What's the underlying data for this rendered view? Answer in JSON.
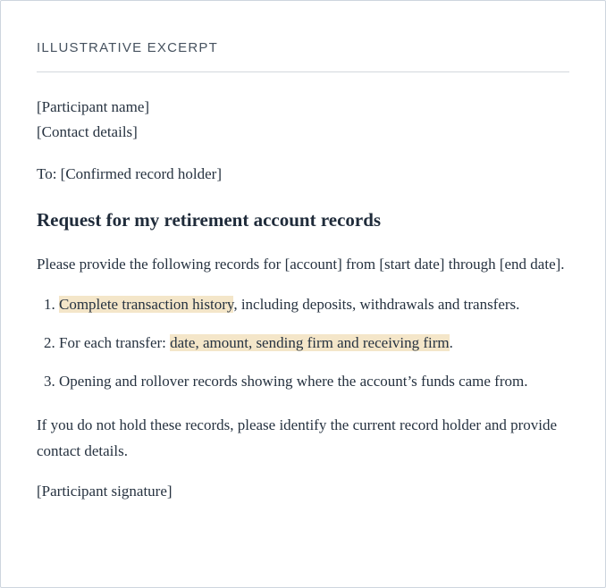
{
  "header": {
    "eyebrow": "ILLUSTRATIVE EXCERPT"
  },
  "letter": {
    "participant_name": "[Participant name]",
    "contact_details": "[Contact details]",
    "to_line": "To: [Confirmed record holder]",
    "title": "Request for my retirement account records",
    "intro": "Please provide the following records for [account] from [start date] through [end date].",
    "items": [
      {
        "highlight": "Complete transaction history",
        "rest": ", including deposits, withdrawals and transfers."
      },
      {
        "prefix": "For each transfer: ",
        "highlight": "date, amount, sending firm and receiving firm",
        "suffix": "."
      },
      {
        "text": "Opening and rollover records showing where the account’s funds came from."
      }
    ],
    "closing": "If you do not hold these records, please identify the current record holder and provide contact details.",
    "signature": "[Participant signature]"
  },
  "colors": {
    "highlight": "#f4e6c9",
    "text": "#263240",
    "rule": "#d3d8dd"
  }
}
